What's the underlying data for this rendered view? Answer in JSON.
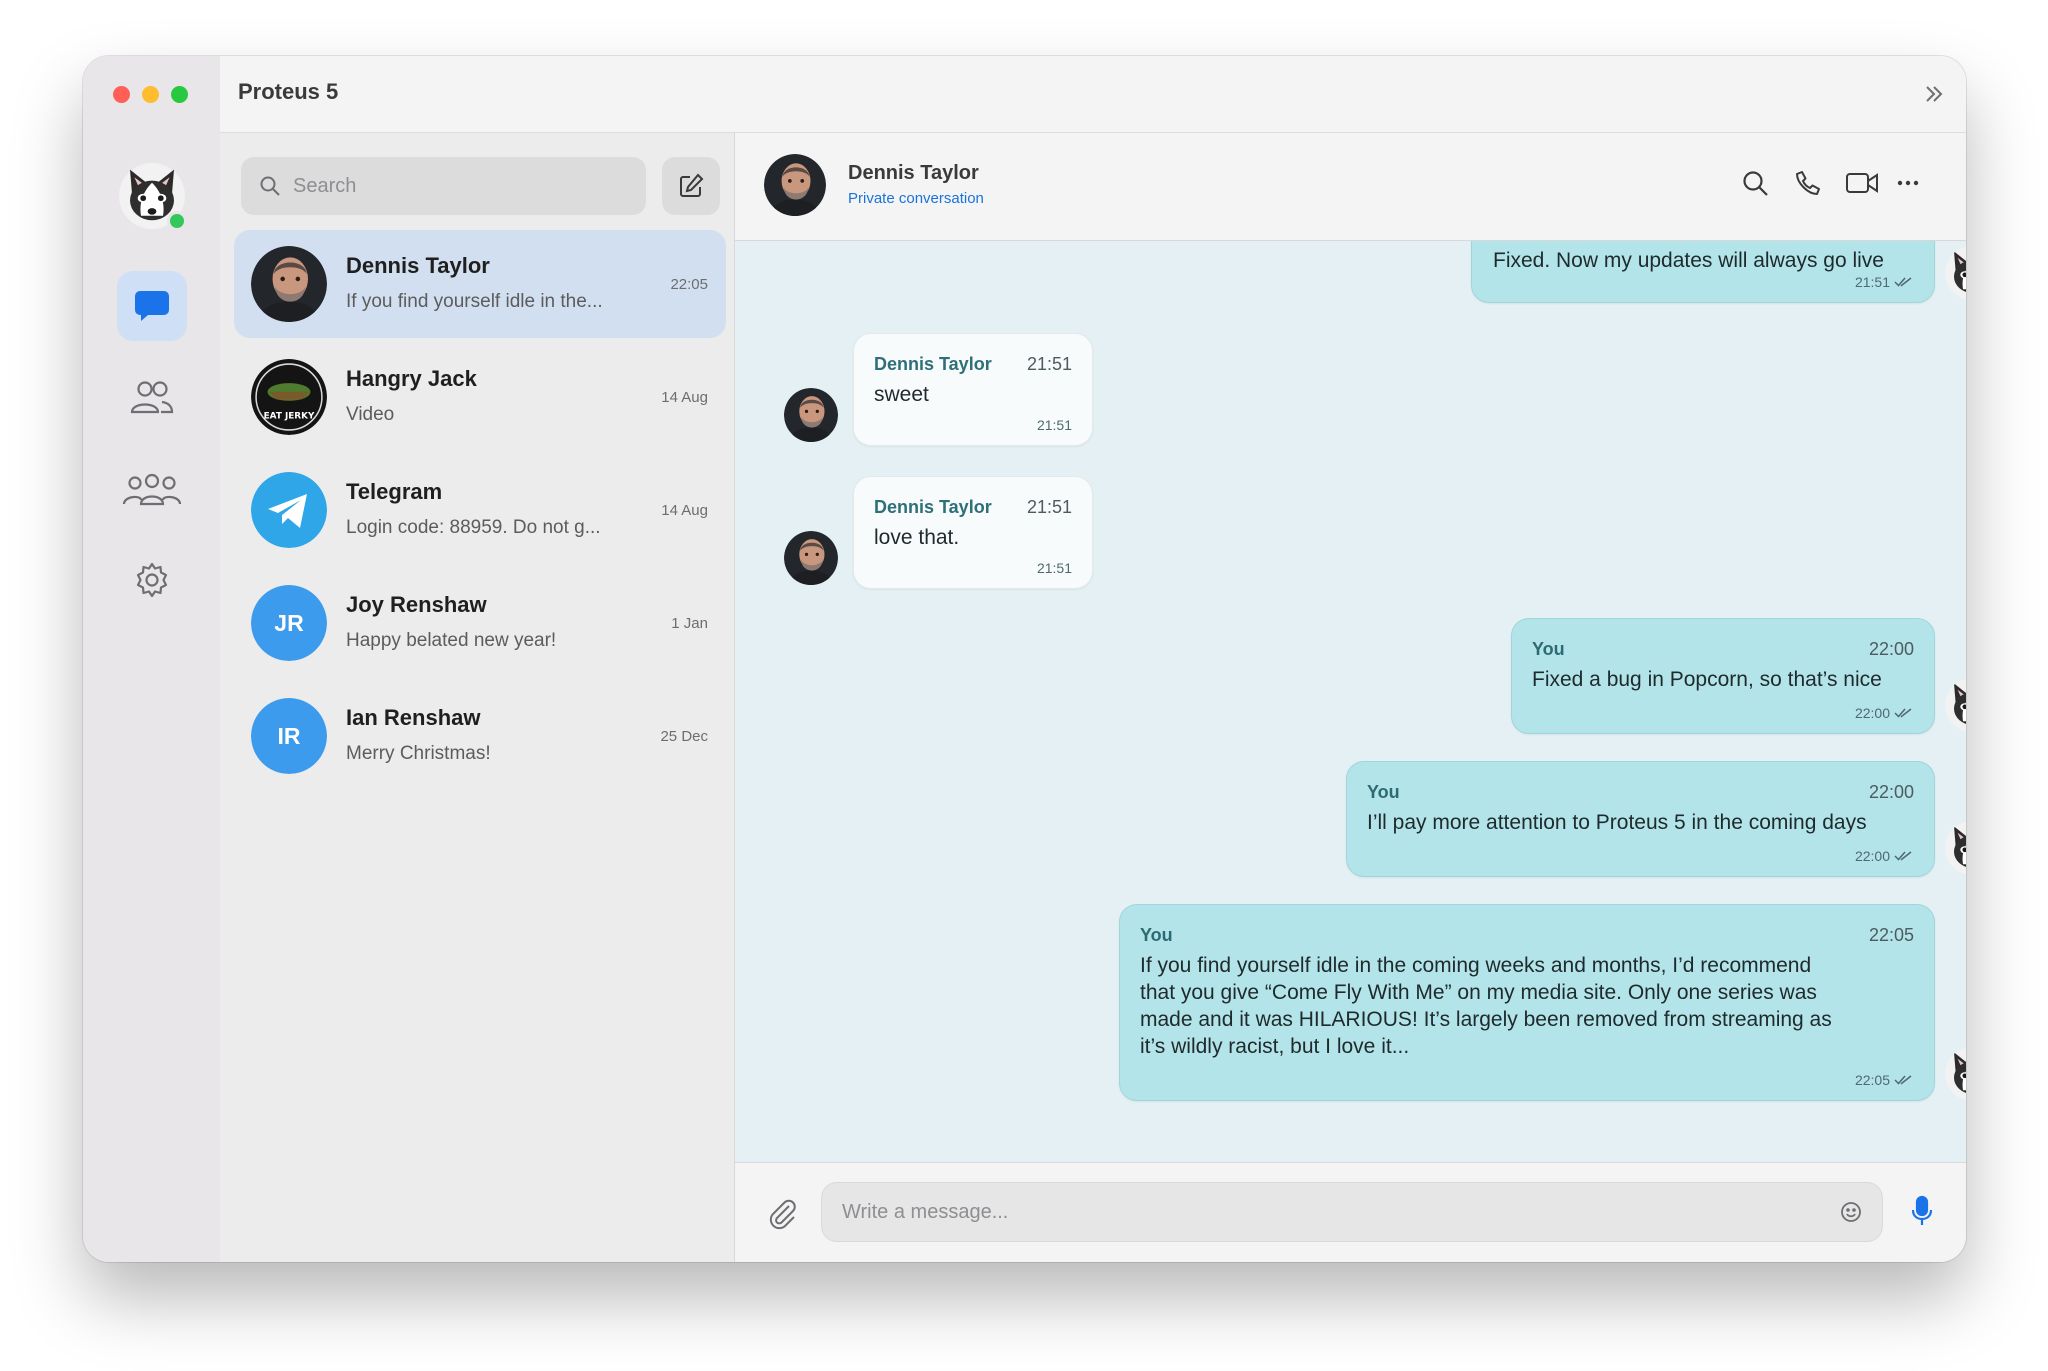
{
  "app": {
    "title": "Proteus 5"
  },
  "search": {
    "placeholder": "Search"
  },
  "chats": [
    {
      "name": "Dennis Taylor",
      "preview": "If you find yourself idle in the...",
      "time": "22:05",
      "active": true,
      "avatar": "photo-dennis"
    },
    {
      "name": "Hangry Jack",
      "preview": "Video",
      "time": "14 Aug",
      "avatar": "jerky-logo"
    },
    {
      "name": "Telegram",
      "preview": "Login code: 88959. Do not g...",
      "time": "14 Aug",
      "avatar": "telegram-logo"
    },
    {
      "name": "Joy Renshaw",
      "preview": "Happy belated new year!",
      "time": "1 Jan",
      "initials": "JR"
    },
    {
      "name": "Ian Renshaw",
      "preview": "Merry Christmas!",
      "time": "25 Dec",
      "initials": "IR"
    }
  ],
  "conversation": {
    "name": "Dennis Taylor",
    "status": "Private conversation"
  },
  "messages": [
    {
      "direction": "out",
      "text": "Fixed. Now my updates will always go live",
      "time": "21:51"
    },
    {
      "direction": "in",
      "sender": "Dennis Taylor",
      "header_time": "21:51",
      "text": "sweet",
      "time": "21:51"
    },
    {
      "direction": "in",
      "sender": "Dennis Taylor",
      "header_time": "21:51",
      "text": "love that.",
      "time": "21:51"
    },
    {
      "direction": "out",
      "sender": "You",
      "header_time": "22:00",
      "text": "Fixed a bug in Popcorn, so that’s nice",
      "time": "22:00"
    },
    {
      "direction": "out",
      "sender": "You",
      "header_time": "22:00",
      "text": "I’ll pay more attention to Proteus 5 in the coming days",
      "time": "22:00"
    },
    {
      "direction": "out",
      "sender": "You",
      "header_time": "22:05",
      "text_lines": [
        "If you find yourself idle in the coming weeks and months, I’d recommend",
        "that you give “Come Fly With Me” on my media site. Only one series was",
        "made and it was HILARIOUS! It’s largely been removed from streaming as",
        "it’s wildly racist, but I love it..."
      ],
      "time": "22:05"
    }
  ],
  "composer": {
    "placeholder": "Write a message..."
  },
  "colors": {
    "accent": "#1a73d8",
    "outgoing_bubble": "#b3e4e9",
    "incoming_bubble": "#f8fbfc",
    "initials_bg": "#3d9bed",
    "online": "#34c759"
  }
}
